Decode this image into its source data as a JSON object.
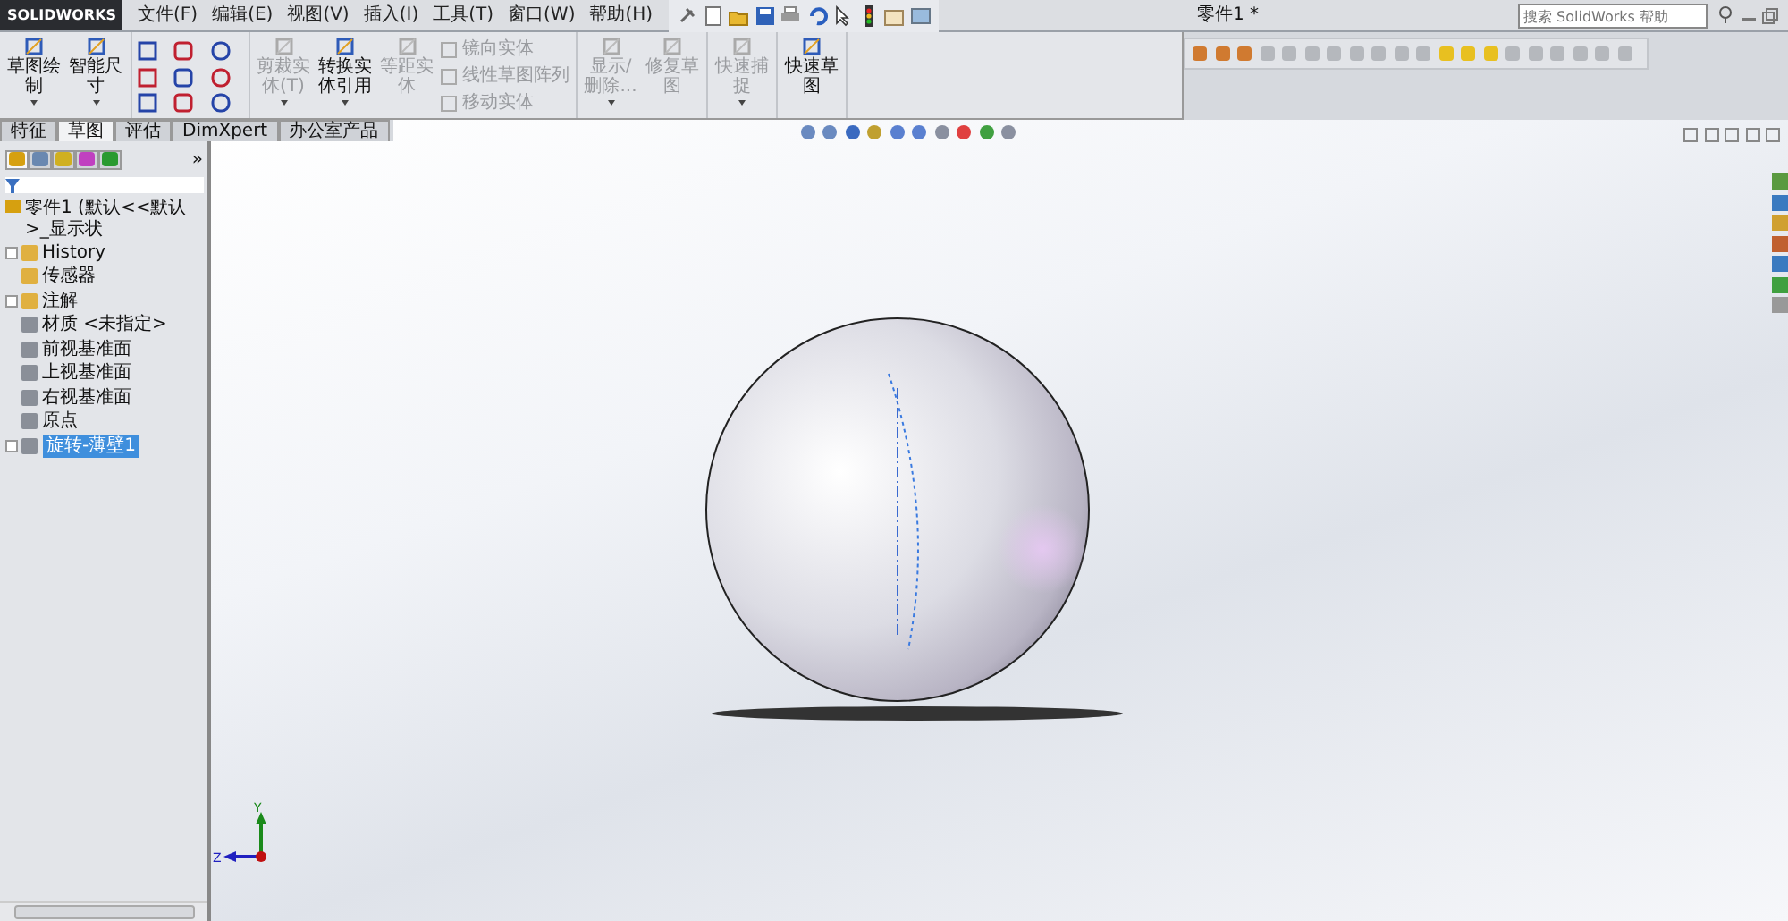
{
  "app": {
    "logo_text": "SOLIDWORKS",
    "menu": [
      "文件(F)",
      "编辑(E)",
      "视图(V)",
      "插入(I)",
      "工具(T)",
      "窗口(W)",
      "帮助(H)"
    ],
    "document_title": "零件1 *",
    "search": {
      "placeholder": "搜索 SolidWorks 帮助"
    }
  },
  "ribbon_groups": [
    [
      {
        "kind": "large",
        "label": "草图绘制",
        "disabled": false,
        "dropdown": true
      },
      {
        "kind": "large",
        "label": "智能尺寸",
        "disabled": false,
        "dropdown": true
      }
    ],
    [
      {
        "kind": "tool_grid"
      }
    ],
    [
      {
        "kind": "large",
        "label": "剪裁实体(T)",
        "disabled": true,
        "dropdown": true
      },
      {
        "kind": "large",
        "label": "转换实体引用",
        "disabled": false,
        "dropdown": true
      },
      {
        "kind": "large",
        "label": "等距实体",
        "disabled": true,
        "dropdown": false
      },
      {
        "kind": "list",
        "entries": [
          {
            "label": "镜向实体",
            "disabled": true
          },
          {
            "label": "线性草图阵列",
            "disabled": true
          },
          {
            "label": "移动实体",
            "disabled": true
          }
        ]
      }
    ],
    [
      {
        "kind": "large",
        "label": "显示/删除...",
        "disabled": true,
        "dropdown": true
      },
      {
        "kind": "large",
        "label": "修复草图",
        "disabled": true,
        "dropdown": false
      }
    ],
    [
      {
        "kind": "large",
        "label": "快速捕捉",
        "disabled": true,
        "dropdown": true
      }
    ],
    [
      {
        "kind": "large",
        "label": "快速草图",
        "disabled": false,
        "dropdown": false
      }
    ]
  ],
  "command_tabs": [
    {
      "label": "特征",
      "selected": false
    },
    {
      "label": "草图",
      "selected": true
    },
    {
      "label": "评估",
      "selected": false
    },
    {
      "label": "DimXpert",
      "selected": false
    },
    {
      "label": "办公室产品",
      "selected": false
    }
  ],
  "manager_tabs": [
    {
      "selected": true
    },
    {
      "selected": false
    },
    {
      "selected": false
    },
    {
      "selected": false
    },
    {
      "selected": false
    }
  ],
  "manager_more": "»",
  "feature_tree": {
    "label": "零件1 (默认<<默认>_显示状",
    "children": [
      {
        "label": "History",
        "has_children": true,
        "selected": false
      },
      {
        "label": "传感器",
        "has_children": false,
        "selected": false
      },
      {
        "label": "注解",
        "has_children": true,
        "selected": false
      },
      {
        "label": "材质 <未指定>",
        "has_children": false,
        "selected": false
      },
      {
        "label": "前视基准面",
        "has_children": false,
        "selected": false
      },
      {
        "label": "上视基准面",
        "has_children": false,
        "selected": false
      },
      {
        "label": "右视基准面",
        "has_children": false,
        "selected": false
      },
      {
        "label": "原点",
        "has_children": false,
        "selected": false
      },
      {
        "label": "旋转-薄壁1",
        "has_children": true,
        "selected": true
      }
    ]
  },
  "triad": {
    "y_label": "Y",
    "z_label": "Z"
  }
}
